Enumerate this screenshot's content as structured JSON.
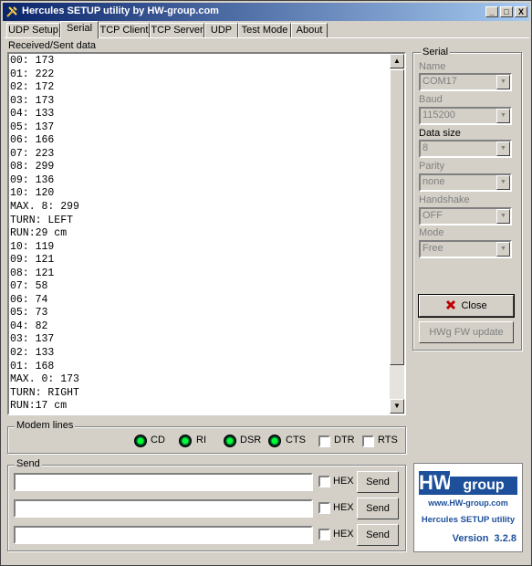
{
  "window": {
    "title": "Hercules SETUP utility by HW-group.com"
  },
  "title_buttons": {
    "minimize": "_",
    "maximize": "□",
    "close": "X"
  },
  "tabs": [
    "UDP Setup",
    "Serial",
    "TCP Client",
    "TCP Server",
    "UDP",
    "Test Mode",
    "About"
  ],
  "selected_tab": "Serial",
  "terminal": {
    "label": "Received/Sent data",
    "lines": [
      "00: 173",
      "01: 222",
      "02: 172",
      "03: 173",
      "04: 133",
      "05: 137",
      "06: 166",
      "07: 223",
      "08: 299",
      "09: 136",
      "10: 120",
      "MAX. 8: 299",
      "TURN: LEFT",
      "RUN:29 cm",
      "10: 119",
      "09: 121",
      "08: 121",
      "07: 58",
      "06: 74",
      "05: 73",
      "04: 82",
      "03: 137",
      "02: 133",
      "01: 168",
      "MAX. 0: 173",
      "TURN: RIGHT",
      "RUN:17 cm"
    ]
  },
  "serial": {
    "group_label": "Serial",
    "name_label": "Name",
    "name_value": "COM17",
    "baud_label": "Baud",
    "baud_value": "115200",
    "datasize_label": "Data size",
    "datasize_value": "8",
    "parity_label": "Parity",
    "parity_value": "none",
    "handshake_label": "Handshake",
    "handshake_value": "OFF",
    "mode_label": "Mode",
    "mode_value": "Free",
    "close_label": "Close",
    "fw_label": "HWg FW update"
  },
  "modem": {
    "label": "Modem lines",
    "leds": [
      "CD",
      "RI",
      "DSR",
      "CTS"
    ],
    "checks": [
      "DTR",
      "RTS"
    ]
  },
  "send": {
    "label": "Send",
    "hex_label": "HEX",
    "send_label": "Send",
    "rows": [
      {
        "value": ""
      },
      {
        "value": ""
      },
      {
        "value": ""
      }
    ]
  },
  "logo": {
    "brand": "HW",
    "brand2": "group",
    "url": "www.HW-group.com",
    "product": "Hercules SETUP utility",
    "version": "Version  3.2.8"
  }
}
